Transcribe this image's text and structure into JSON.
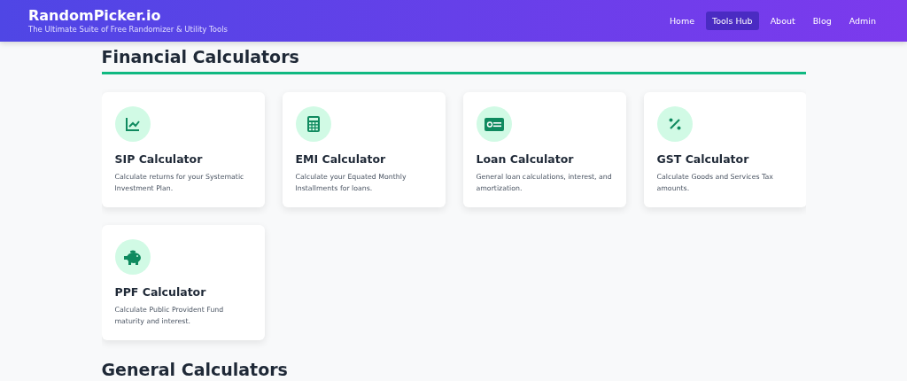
{
  "header": {
    "brand": "RandomPicker.io",
    "tagline": "The Ultimate Suite of Free Randomizer & Utility Tools",
    "nav": [
      {
        "label": "Home",
        "selected": false
      },
      {
        "label": "Tools Hub",
        "selected": true
      },
      {
        "label": "About",
        "selected": false
      },
      {
        "label": "Blog",
        "selected": false
      },
      {
        "label": "Admin",
        "selected": false
      }
    ]
  },
  "sections": [
    {
      "title": "Financial Calculators",
      "cards": [
        {
          "kind": "chart",
          "title": "SIP Calculator",
          "description": "Calculate returns for your Systematic Investment Plan."
        },
        {
          "kind": "calculator",
          "title": "EMI Calculator",
          "description": "Calculate your Equated Monthly Installments for loans."
        },
        {
          "kind": "money",
          "title": "Loan Calculator",
          "description": "General loan calculations, interest, and amortization."
        },
        {
          "kind": "percent",
          "title": "GST Calculator",
          "description": "Calculate Goods and Services Tax amounts."
        },
        {
          "kind": "piggy",
          "title": "PPF Calculator",
          "description": "Calculate Public Provident Fund maturity and interest."
        }
      ]
    },
    {
      "title": "General Calculators"
    }
  ]
}
